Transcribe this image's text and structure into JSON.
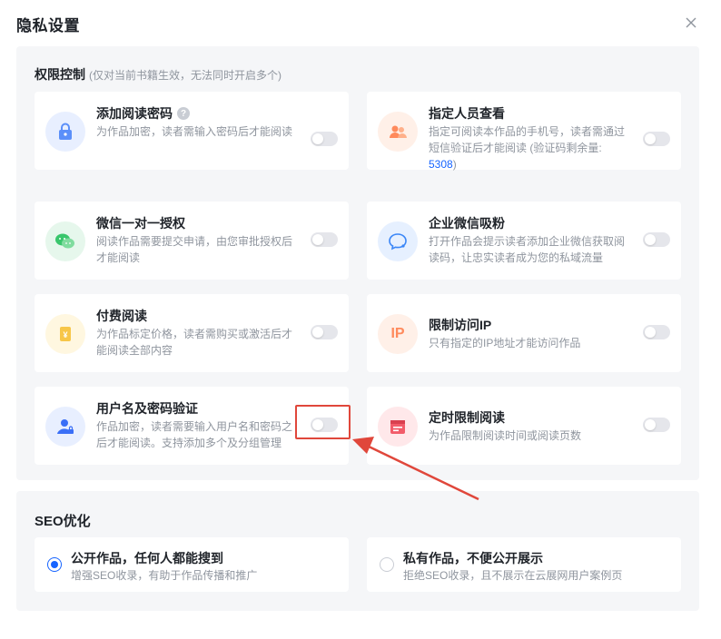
{
  "dialog": {
    "title": "隐私设置"
  },
  "permissions": {
    "heading": "权限控制",
    "note": "(仅对当前书籍生效，无法同时开启多个)",
    "items": [
      {
        "title": "添加阅读密码",
        "desc": "为作品加密，读者需输入密码后才能阅读",
        "icon": "lock-icon",
        "enabled": false,
        "color": "#5b8ff9"
      },
      {
        "title": "指定人员查看",
        "desc_before": "指定可阅读本作品的手机号，读者需通过短信验证后才能阅读 (验证码剩余量:",
        "count": "5308",
        "desc_after": ")",
        "icon": "users-icon",
        "enabled": false,
        "color": "#ff8a5c"
      },
      {
        "title": "微信一对一授权",
        "desc": "阅读作品需要提交申请，由您审批授权后才能阅读",
        "icon": "wechat-icon",
        "enabled": false,
        "color": "#39c66c"
      },
      {
        "title": "企业微信吸粉",
        "desc": "打开作品会提示读者添加企业微信获取阅读码，让忠实读者成为您的私域流量",
        "icon": "wecom-icon",
        "enabled": false,
        "color": "#3a86f7"
      },
      {
        "title": "付费阅读",
        "desc": "为作品标定价格，读者需购买或激活后才能阅读全部内容",
        "icon": "price-tag-icon",
        "enabled": false,
        "color": "#f7c648"
      },
      {
        "title": "限制访问IP",
        "desc": "只有指定的IP地址才能访问作品",
        "icon": "ip-icon",
        "enabled": false,
        "color": "#ff8a5c",
        "icon_text": "IP"
      },
      {
        "title": "用户名及密码验证",
        "desc": "作品加密，读者需要输入用户名和密码之后才能阅读。支持添加多个及分组管理",
        "icon": "user-lock-icon",
        "enabled": false,
        "color": "#3a6ff7"
      },
      {
        "title": "定时限制阅读",
        "desc": "为作品限制阅读时间或阅读页数",
        "icon": "calendar-icon",
        "enabled": false,
        "color": "#f25c6a"
      }
    ]
  },
  "seo": {
    "heading": "SEO优化",
    "options": [
      {
        "title": "公开作品，任何人都能搜到",
        "desc": "增强SEO收录，有助于作品传播和推广",
        "selected": true
      },
      {
        "title": "私有作品，不便公开展示",
        "desc": "拒绝SEO收录，且不展示在云展网用户案例页",
        "selected": false
      }
    ]
  },
  "colors": {
    "accent": "#1664ff",
    "annotation": "#e0473b"
  }
}
